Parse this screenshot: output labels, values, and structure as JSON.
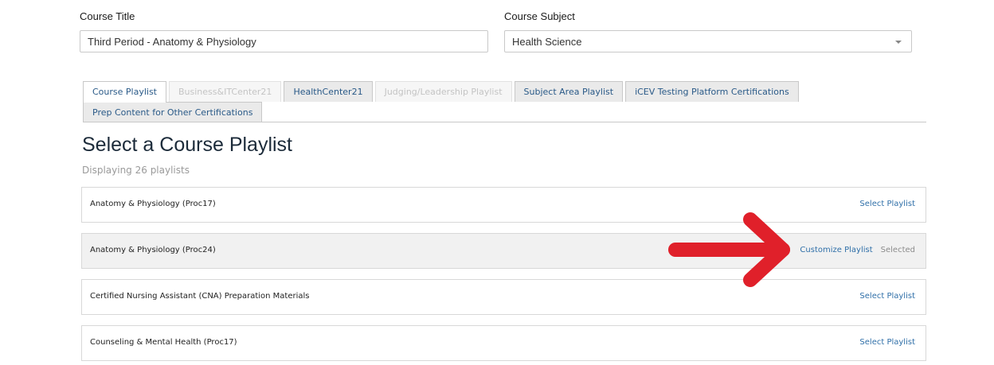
{
  "form": {
    "course_title_label": "Course Title",
    "course_title_value": "Third Period - Anatomy & Physiology",
    "course_subject_label": "Course Subject",
    "course_subject_value": "Health Science"
  },
  "tabs": [
    {
      "label": "Course Playlist",
      "state": "active"
    },
    {
      "label": "Business&ITCenter21",
      "state": "disabled"
    },
    {
      "label": "HealthCenter21",
      "state": "normal"
    },
    {
      "label": "Judging/Leadership Playlist",
      "state": "disabled"
    },
    {
      "label": "Subject Area Playlist",
      "state": "normal"
    },
    {
      "label": "iCEV Testing Platform Certifications",
      "state": "normal"
    },
    {
      "label": "Prep Content for Other Certifications",
      "state": "normal"
    }
  ],
  "main": {
    "title": "Select a Course Playlist",
    "count_text": "Displaying 26 playlists"
  },
  "playlists": [
    {
      "name": "Anatomy & Physiology (Proc17)",
      "action": "Select Playlist"
    },
    {
      "name": "Anatomy & Physiology (Proc24)",
      "action": "Customize Playlist",
      "status": "Selected"
    },
    {
      "name": "Certified Nursing Assistant (CNA) Preparation Materials",
      "action": "Select Playlist"
    },
    {
      "name": "Counseling & Mental Health (Proc17)",
      "action": "Select Playlist"
    }
  ],
  "colors": {
    "link": "#2f6fa8",
    "annotation_arrow": "#e0202a"
  },
  "icons": {
    "subject_dropdown": "chevron-down-icon",
    "annotation": "red-arrow-icon"
  }
}
